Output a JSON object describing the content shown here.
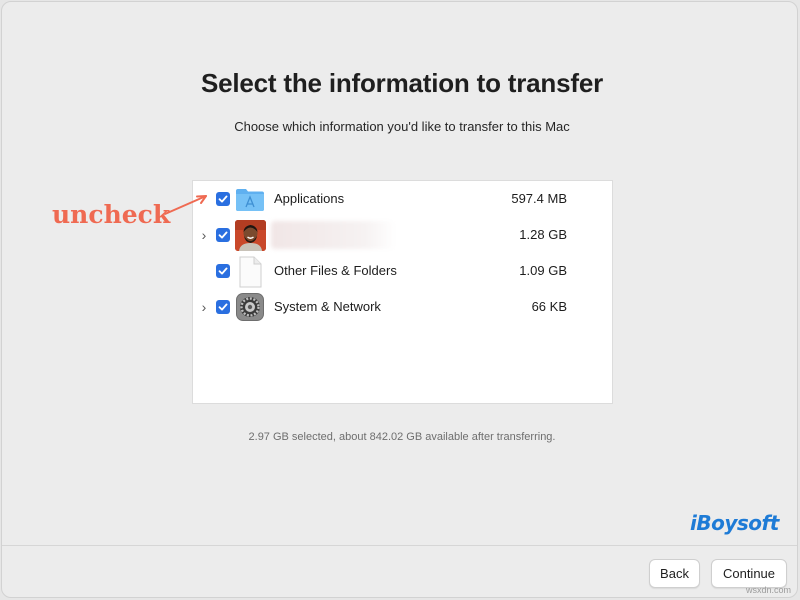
{
  "header": {
    "title": "Select the information to transfer",
    "subtitle": "Choose which information you'd like to transfer to this Mac"
  },
  "items": [
    {
      "label": "Applications",
      "size": "597.4 MB",
      "checked": true,
      "expandable": false,
      "icon": "applications-folder-icon"
    },
    {
      "label": "",
      "size": "1.28 GB",
      "checked": true,
      "expandable": true,
      "icon": "user-avatar"
    },
    {
      "label": "Other Files & Folders",
      "size": "1.09 GB",
      "checked": true,
      "expandable": false,
      "icon": "document-icon"
    },
    {
      "label": "System & Network",
      "size": "66 KB",
      "checked": true,
      "expandable": true,
      "icon": "gear-icon"
    }
  ],
  "summary": "2.97 GB selected, about 842.02 GB available after transferring.",
  "annotation": "uncheck",
  "brand": "iBoysoft",
  "buttons": {
    "back": "Back",
    "continue": "Continue"
  },
  "watermark": "wsxdn.com",
  "colors": {
    "accent": "#2a6fe0",
    "annotation": "#ef6a52",
    "brand": "#1e7bd6"
  }
}
